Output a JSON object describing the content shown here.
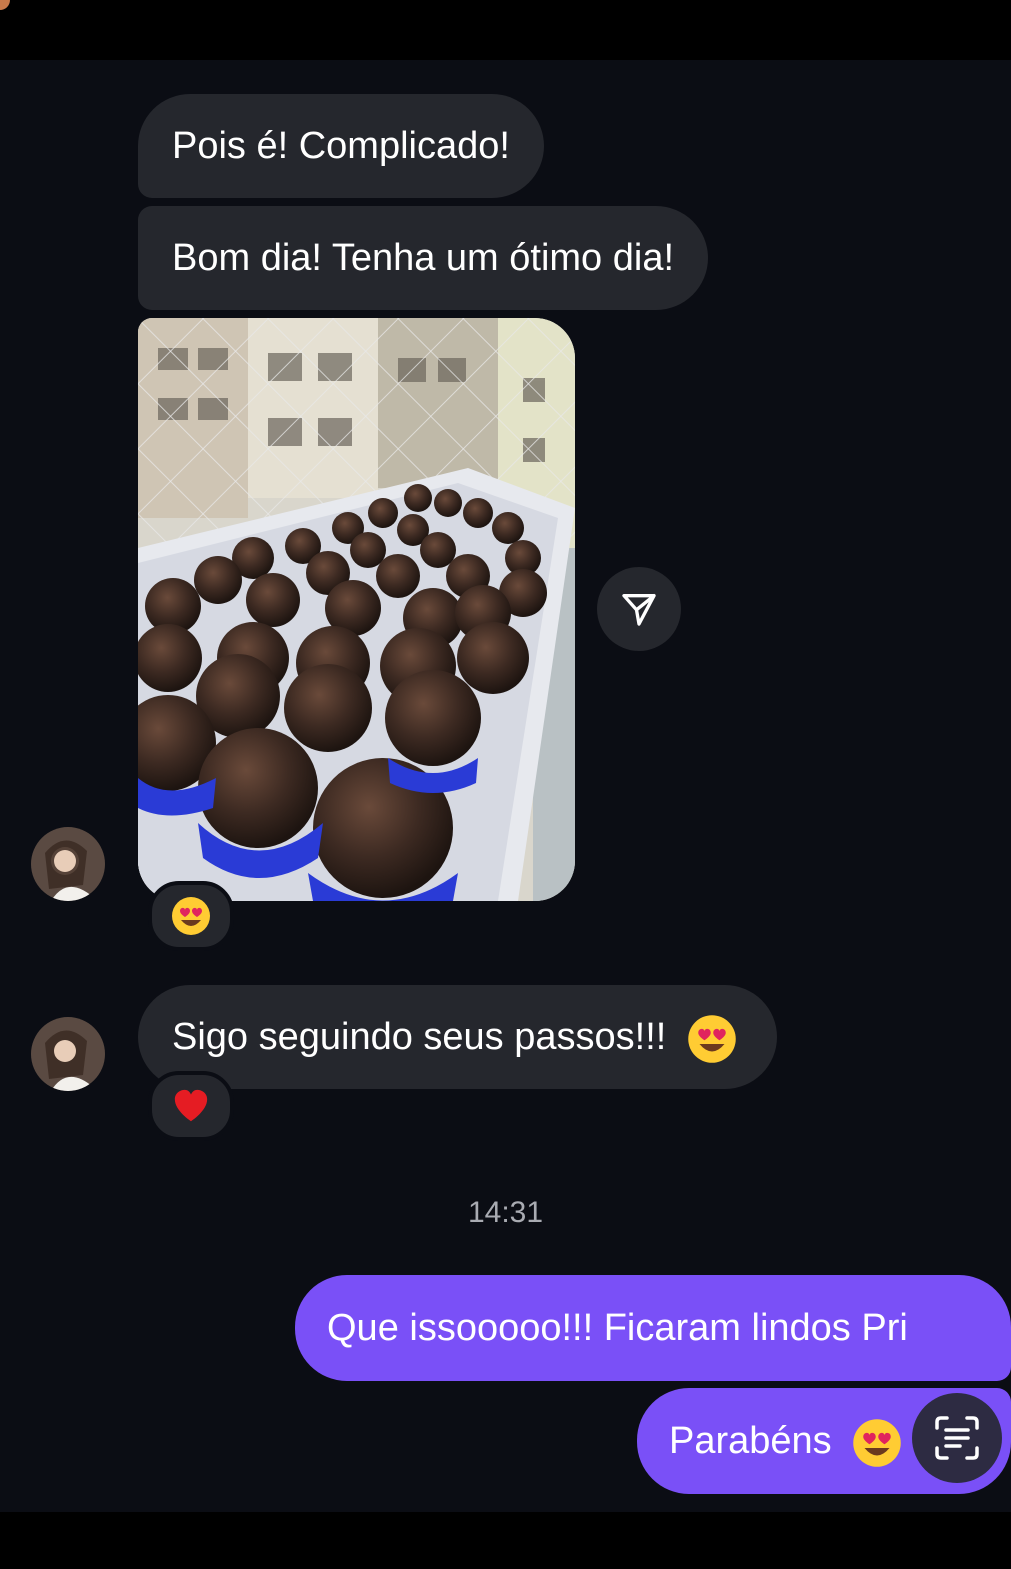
{
  "messages": {
    "incoming_1": "Pois é! Complicado!",
    "incoming_2": "Bom dia! Tenha um ótimo dia!",
    "incoming_3": "Sigo seguindo seus passos!!!",
    "outgoing_1": "Que issooooo!!! Ficaram lindos Pri",
    "outgoing_2": "Parabéns"
  },
  "timestamp": "14:31",
  "reactions": {
    "photo": "heart-eyes-emoji",
    "incoming_3": "red-heart-emoji"
  },
  "icons": {
    "share": "paper-plane-icon",
    "scan": "text-scan-icon"
  },
  "colors": {
    "background": "#0b0d14",
    "incoming_bubble": "#25272d",
    "outgoing_bubble": "#7a50f7",
    "timestamp_text": "#a9abb2"
  }
}
